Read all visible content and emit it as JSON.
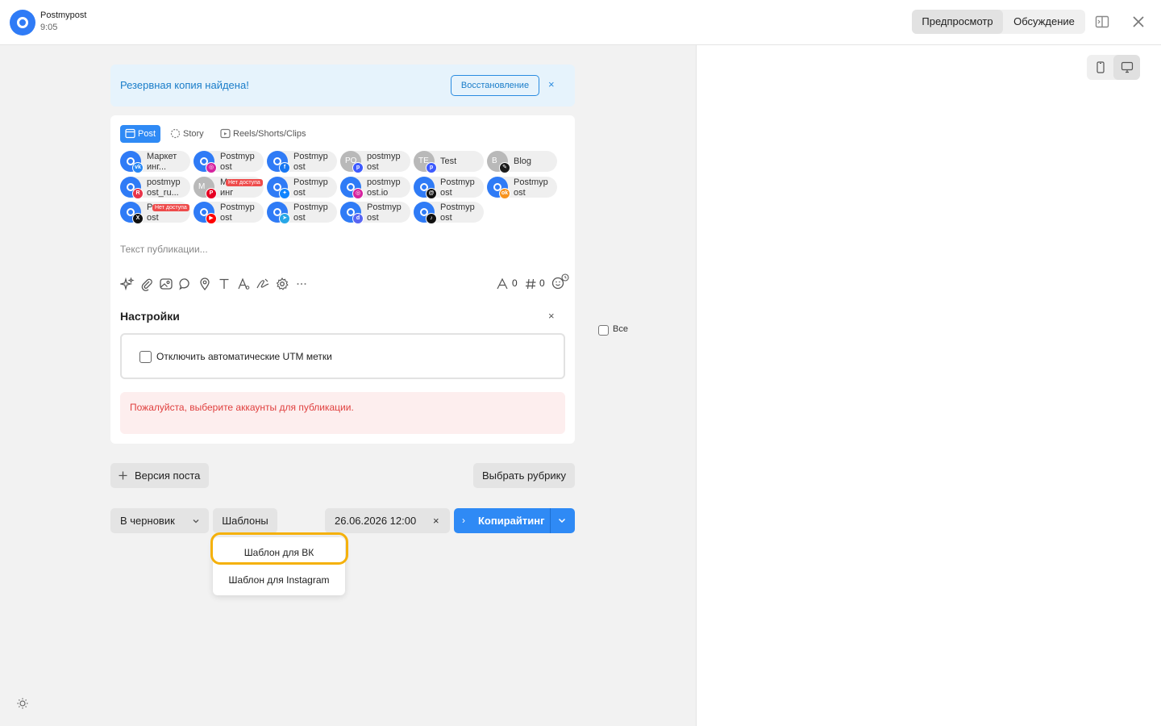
{
  "header": {
    "app_name": "Postmypost",
    "time": "9:05",
    "preview_label": "Предпросмотр",
    "discussion_label": "Обсуждение"
  },
  "backup": {
    "message": "Резервная копия найдена!",
    "restore_label": "Восстановление",
    "close": "×"
  },
  "tabs": [
    {
      "label": "Post",
      "icon": "post-icon",
      "active": true
    },
    {
      "label": "Story",
      "icon": "story-icon",
      "active": false
    },
    {
      "label": "Reels/Shorts/Clips",
      "icon": "reels-icon",
      "active": false
    }
  ],
  "accounts": [
    {
      "line1": "Маркет",
      "line2": "инг...",
      "network": "vk",
      "badge_color": "#2787f5",
      "badge_glyph": "vk"
    },
    {
      "line1": "Postmyp",
      "line2": "ost",
      "network": "instagram",
      "badge_color": "#d6249f",
      "badge_glyph": "◎"
    },
    {
      "line1": "Postmyp",
      "line2": "ost",
      "network": "facebook",
      "badge_color": "#1877f2",
      "badge_glyph": "f"
    },
    {
      "line1": "postmyp",
      "line2": "ost",
      "initials": "PO",
      "network": "pinterest-ok",
      "badge_color": "#3d5afe",
      "badge_glyph": "p"
    },
    {
      "line1": "Test",
      "line2": "",
      "initials": "TE",
      "network": "test",
      "badge_color": "#3d5afe",
      "badge_glyph": "p"
    },
    {
      "line1": "Blog",
      "line2": "",
      "initials": "B",
      "network": "blog",
      "badge_color": "#1b1b1b",
      "badge_glyph": "✎"
    },
    {
      "line1": "postmyp",
      "line2": "ost_ru...",
      "network": "rutube",
      "badge_color": "#e9344a",
      "badge_glyph": "R"
    },
    {
      "line1": "М",
      "line2": "инг",
      "initials": "M",
      "network": "pinterest",
      "badge_color": "#e60023",
      "badge_glyph": "P",
      "no_access": "Нет доступа"
    },
    {
      "line1": "Postmyp",
      "line2": "ost",
      "network": "bluesky",
      "badge_color": "#1185fe",
      "badge_glyph": "✦"
    },
    {
      "line1": "postmyp",
      "line2": "ost.io",
      "network": "instagram",
      "badge_color": "#d6249f",
      "badge_glyph": "◎"
    },
    {
      "line1": "Postmyp",
      "line2": "ost",
      "network": "threads",
      "badge_color": "#111111",
      "badge_glyph": "@"
    },
    {
      "line1": "Postmyp",
      "line2": "ost",
      "network": "ok",
      "badge_color": "#f7931e",
      "badge_glyph": "ok"
    },
    {
      "line1": "P",
      "line2": "ost",
      "network": "x",
      "badge_color": "#111111",
      "badge_glyph": "X",
      "no_access": "Нет доступа"
    },
    {
      "line1": "Postmyp",
      "line2": "ost",
      "network": "youtube",
      "badge_color": "#ff0000",
      "badge_glyph": "▶"
    },
    {
      "line1": "Postmyp",
      "line2": "ost",
      "network": "telegram",
      "badge_color": "#27a7e7",
      "badge_glyph": "➤"
    },
    {
      "line1": "Postmyp",
      "line2": "ost",
      "network": "discord",
      "badge_color": "#5865f2",
      "badge_glyph": "d"
    },
    {
      "line1": "Postmyp",
      "line2": "ost",
      "network": "tiktok",
      "badge_color": "#111111",
      "badge_glyph": "♪"
    }
  ],
  "all_label": "Все",
  "post_placeholder": "Текст публикации...",
  "counters": {
    "chars": "0",
    "hashtags": "0"
  },
  "settings": {
    "title": "Настройки",
    "close": "×",
    "utm_label": "Отключить автоматические UTM метки",
    "error": "Пожалуйста, выберите аккаунты для публикации."
  },
  "actions": {
    "version_label": "Версия поста",
    "rubric_label": "Выбрать рубрику",
    "draft_label": "В черновик",
    "templates_label": "Шаблоны",
    "date_value": "26.06.2026 12:00",
    "date_clear": "×",
    "copywriting_label": "Копирайтинг"
  },
  "templates_menu": [
    {
      "label": "Шаблон для ВК",
      "highlighted": true
    },
    {
      "label": "Шаблон для Instagram",
      "highlighted": false
    }
  ],
  "colors": {
    "accent": "#2f8af5",
    "error": "#e0403f",
    "highlight": "#f5b10b"
  }
}
